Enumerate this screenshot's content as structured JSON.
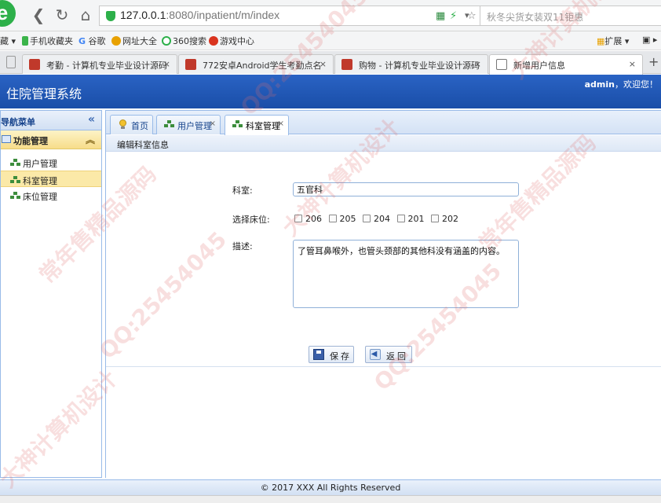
{
  "browser": {
    "url_host": "127.0.0.1",
    "url_rest": ":8080/inpatient/m/index",
    "search_placeholder": "秋冬尖货女装双11钜惠",
    "bookmarks": [
      "藏",
      "手机收藏夹",
      "谷歌",
      "网址大全",
      "360搜索",
      "游戏中心"
    ],
    "bookmarks_right": "扩展",
    "tabs": [
      {
        "title": "考勤 - 计算机专业毕业设计源码",
        "close": "×"
      },
      {
        "title": "772安卓Android学生考勤点名",
        "close": "×"
      },
      {
        "title": "购物 - 计算机专业毕业设计源码",
        "close": "×"
      },
      {
        "title": "新增用户信息",
        "close": "×"
      }
    ],
    "plus": "+"
  },
  "app": {
    "title": "住院管理系统",
    "user": "admin",
    "welcome_suffix": "，欢迎您！"
  },
  "sidebar": {
    "header": "导航菜单",
    "collapse": "«",
    "group": "功能管理",
    "group_toggle": "︽",
    "items": [
      {
        "label": "用户管理"
      },
      {
        "label": "科室管理"
      },
      {
        "label": "床位管理"
      }
    ]
  },
  "panel_tabs": [
    {
      "label": "首页"
    },
    {
      "label": "用户管理",
      "close": "×"
    },
    {
      "label": "科室管理",
      "close": "×"
    }
  ],
  "form": {
    "section_title": "编辑科室信息",
    "dept_label": "科室:",
    "dept_value": "五官科",
    "beds_label": "选择床位:",
    "beds": [
      "206",
      "205",
      "204",
      "201",
      "202"
    ],
    "desc_label": "描述:",
    "desc_value": "了管耳鼻喉外，也管头颈部的其他科没有涵盖的内容。",
    "save_label": "保存",
    "back_label": "返回"
  },
  "footer": {
    "text": "© 2017 XXX All Rights Reserved"
  },
  "watermark": {
    "texts": [
      "QQ:25454045",
      "常年售精品源码",
      "大神计算机设计"
    ]
  },
  "colors": {
    "header_blue": "#1a4ea8",
    "accent_green": "#2db04a",
    "panel_border": "#99bbe8"
  }
}
